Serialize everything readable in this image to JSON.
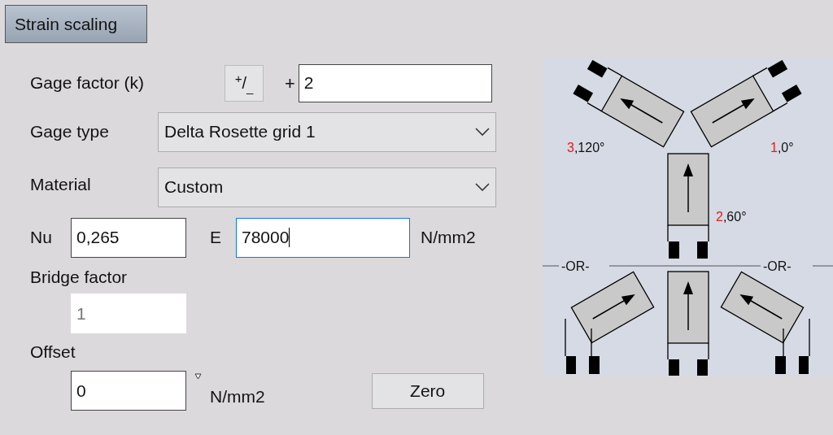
{
  "header_button": "Strain scaling",
  "gage_factor": {
    "label": "Gage factor (k)",
    "sign_button": "$^{+}$/$_{_}$",
    "sign": "+",
    "value": "2"
  },
  "gage_type": {
    "label": "Gage type",
    "value": "Delta Rosette grid 1"
  },
  "material": {
    "label": "Material",
    "value": "Custom"
  },
  "nu": {
    "label": "Nu",
    "value": "0,265",
    "focused": false,
    "disabled": false
  },
  "e": {
    "label": "E",
    "value": "78000",
    "unit": "N/mm2",
    "focused": true,
    "disabled": false
  },
  "bridge_factor": {
    "label": "Bridge factor",
    "value": "1",
    "focused": false,
    "disabled": true
  },
  "offset": {
    "label": "Offset",
    "value": "0",
    "unit": "N/mm2",
    "focused": false,
    "disabled": false
  },
  "zero_button": "Zero",
  "diagram": {
    "labels": [
      {
        "number": "3",
        "angle": ",120°"
      },
      {
        "number": "1",
        "angle": ",0°"
      },
      {
        "number": "2",
        "angle": ",60°"
      }
    ],
    "separators": [
      "-OR-",
      "-OR-"
    ]
  }
}
